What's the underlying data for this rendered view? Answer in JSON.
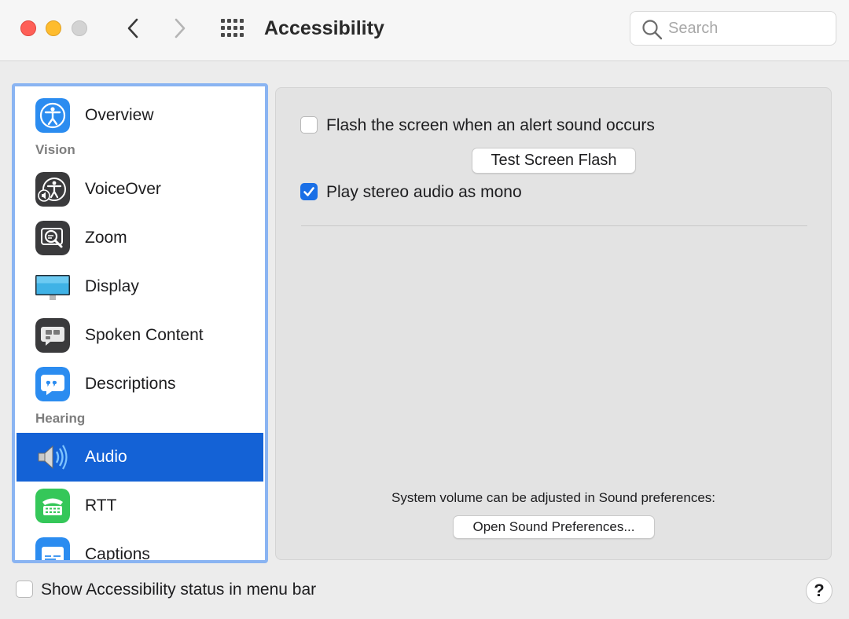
{
  "window": {
    "title": "Accessibility",
    "search_placeholder": "Search"
  },
  "sidebar": {
    "items": [
      {
        "label": "Overview",
        "icon": "accessibility-person-icon",
        "selected": false
      },
      {
        "header": "Vision"
      },
      {
        "label": "VoiceOver",
        "icon": "voiceover-icon",
        "selected": false
      },
      {
        "label": "Zoom",
        "icon": "zoom-icon",
        "selected": false
      },
      {
        "label": "Display",
        "icon": "display-icon",
        "selected": false
      },
      {
        "label": "Spoken Content",
        "icon": "speech-bubble-icon",
        "selected": false
      },
      {
        "label": "Descriptions",
        "icon": "quote-bubble-icon",
        "selected": false
      },
      {
        "header": "Hearing"
      },
      {
        "label": "Audio",
        "icon": "speaker-icon",
        "selected": true
      },
      {
        "label": "RTT",
        "icon": "telephone-icon",
        "selected": false
      },
      {
        "label": "Captions",
        "icon": "captions-icon",
        "selected": false
      }
    ]
  },
  "main": {
    "flash_screen_label": "Flash the screen when an alert sound occurs",
    "flash_screen_checked": false,
    "test_flash_button": "Test Screen Flash",
    "stereo_mono_label": "Play stereo audio as mono",
    "stereo_mono_checked": true,
    "volume_note": "System volume can be adjusted in Sound preferences:",
    "open_sound_button": "Open Sound Preferences..."
  },
  "footer": {
    "status_menu_label": "Show Accessibility status in menu bar",
    "status_menu_checked": false,
    "help_label": "?"
  },
  "colors": {
    "selection": "#1462d6",
    "checkbox_checked": "#1a6fe6",
    "sidebar_focus_ring": "#8ab4f2"
  }
}
